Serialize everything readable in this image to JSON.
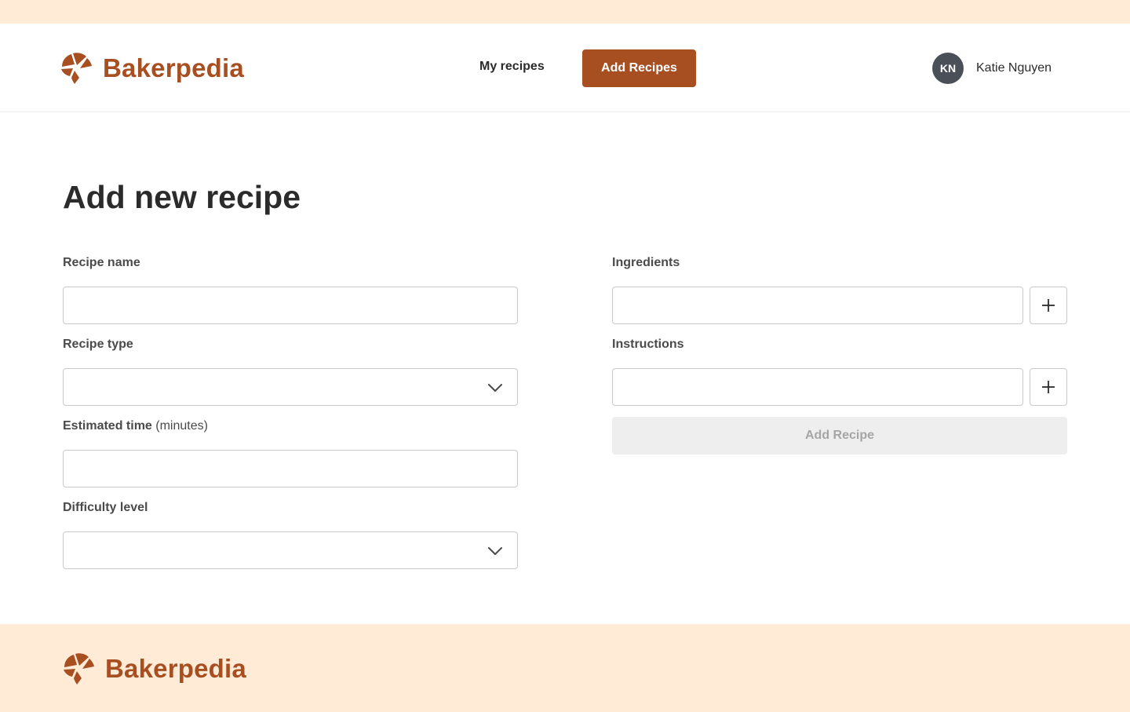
{
  "brand": {
    "name": "Bakerpedia",
    "color": "#a84f22",
    "icon": "croissant-icon"
  },
  "nav": {
    "my_recipes": "My recipes",
    "add_recipes": "Add Recipes"
  },
  "user": {
    "initials": "KN",
    "name": "Katie Nguyen"
  },
  "page": {
    "title": "Add new recipe"
  },
  "form": {
    "recipe_name": {
      "label": "Recipe name",
      "value": ""
    },
    "recipe_type": {
      "label": "Recipe type",
      "value": ""
    },
    "estimated_time": {
      "label": "Estimated time",
      "hint": "(minutes)",
      "value": ""
    },
    "difficulty": {
      "label": "Difficulty level",
      "value": ""
    },
    "ingredients": {
      "label": "Ingredients",
      "value": "",
      "add_icon": "plus-icon"
    },
    "instructions": {
      "label": "Instructions",
      "value": "",
      "add_icon": "plus-icon"
    },
    "submit_label": "Add Recipe"
  },
  "colors": {
    "accent": "#a84f22",
    "band_background": "#ffebd6",
    "avatar": "#4b5058",
    "disabled_button": "#eeeeee"
  }
}
